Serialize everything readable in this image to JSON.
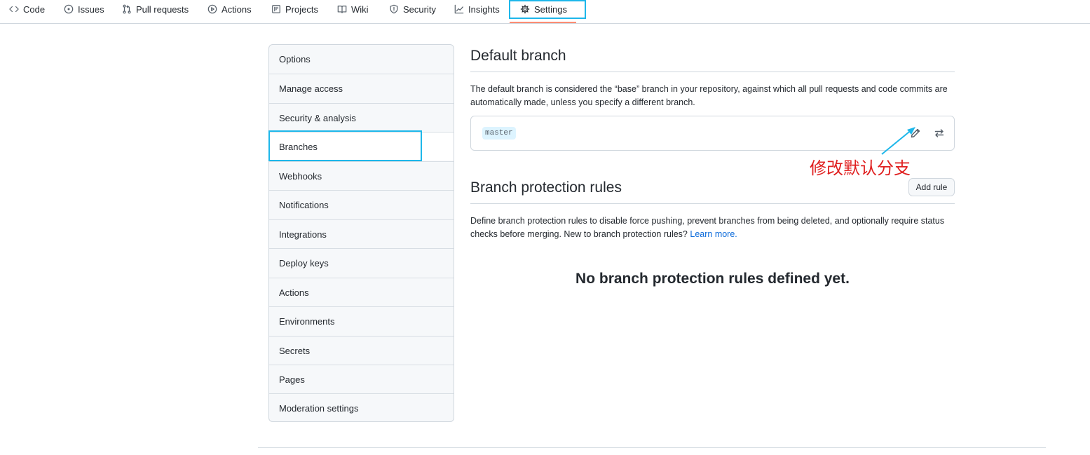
{
  "repo_nav": {
    "tabs": [
      {
        "label": "Code",
        "icon": "code-icon"
      },
      {
        "label": "Issues",
        "icon": "issue-icon"
      },
      {
        "label": "Pull requests",
        "icon": "pull-request-icon"
      },
      {
        "label": "Actions",
        "icon": "play-icon"
      },
      {
        "label": "Projects",
        "icon": "project-icon"
      },
      {
        "label": "Wiki",
        "icon": "book-icon"
      },
      {
        "label": "Security",
        "icon": "shield-icon"
      },
      {
        "label": "Insights",
        "icon": "graph-icon"
      },
      {
        "label": "Settings",
        "icon": "gear-icon",
        "active": true
      }
    ]
  },
  "sidebar": {
    "items": [
      {
        "label": "Options"
      },
      {
        "label": "Manage access"
      },
      {
        "label": "Security & analysis"
      },
      {
        "label": "Branches",
        "active": true
      },
      {
        "label": "Webhooks"
      },
      {
        "label": "Notifications"
      },
      {
        "label": "Integrations"
      },
      {
        "label": "Deploy keys"
      },
      {
        "label": "Actions"
      },
      {
        "label": "Environments"
      },
      {
        "label": "Secrets"
      },
      {
        "label": "Pages"
      },
      {
        "label": "Moderation settings"
      }
    ]
  },
  "default_branch": {
    "title": "Default branch",
    "description": "The default branch is considered the “base” branch in your repository, against which all pull requests and code commits are automatically made, unless you specify a different branch.",
    "branch_name": "master",
    "edit_icon": "pencil-icon",
    "switch_icon": "arrow-switch-icon"
  },
  "protection": {
    "title": "Branch protection rules",
    "add_rule_label": "Add rule",
    "description": "Define branch protection rules to disable force pushing, prevent branches from being deleted, and optionally require status checks before merging. New to branch protection rules?",
    "learn_more": "Learn more.",
    "empty_message": "No branch protection rules defined yet."
  },
  "annotation": {
    "text": "修改默认分支",
    "color": "#e02020",
    "highlight_color": "#1eb7ea"
  },
  "colors": {
    "link": "#0969da",
    "border": "#d0d7de",
    "tab_underline": "#fd8c73"
  }
}
